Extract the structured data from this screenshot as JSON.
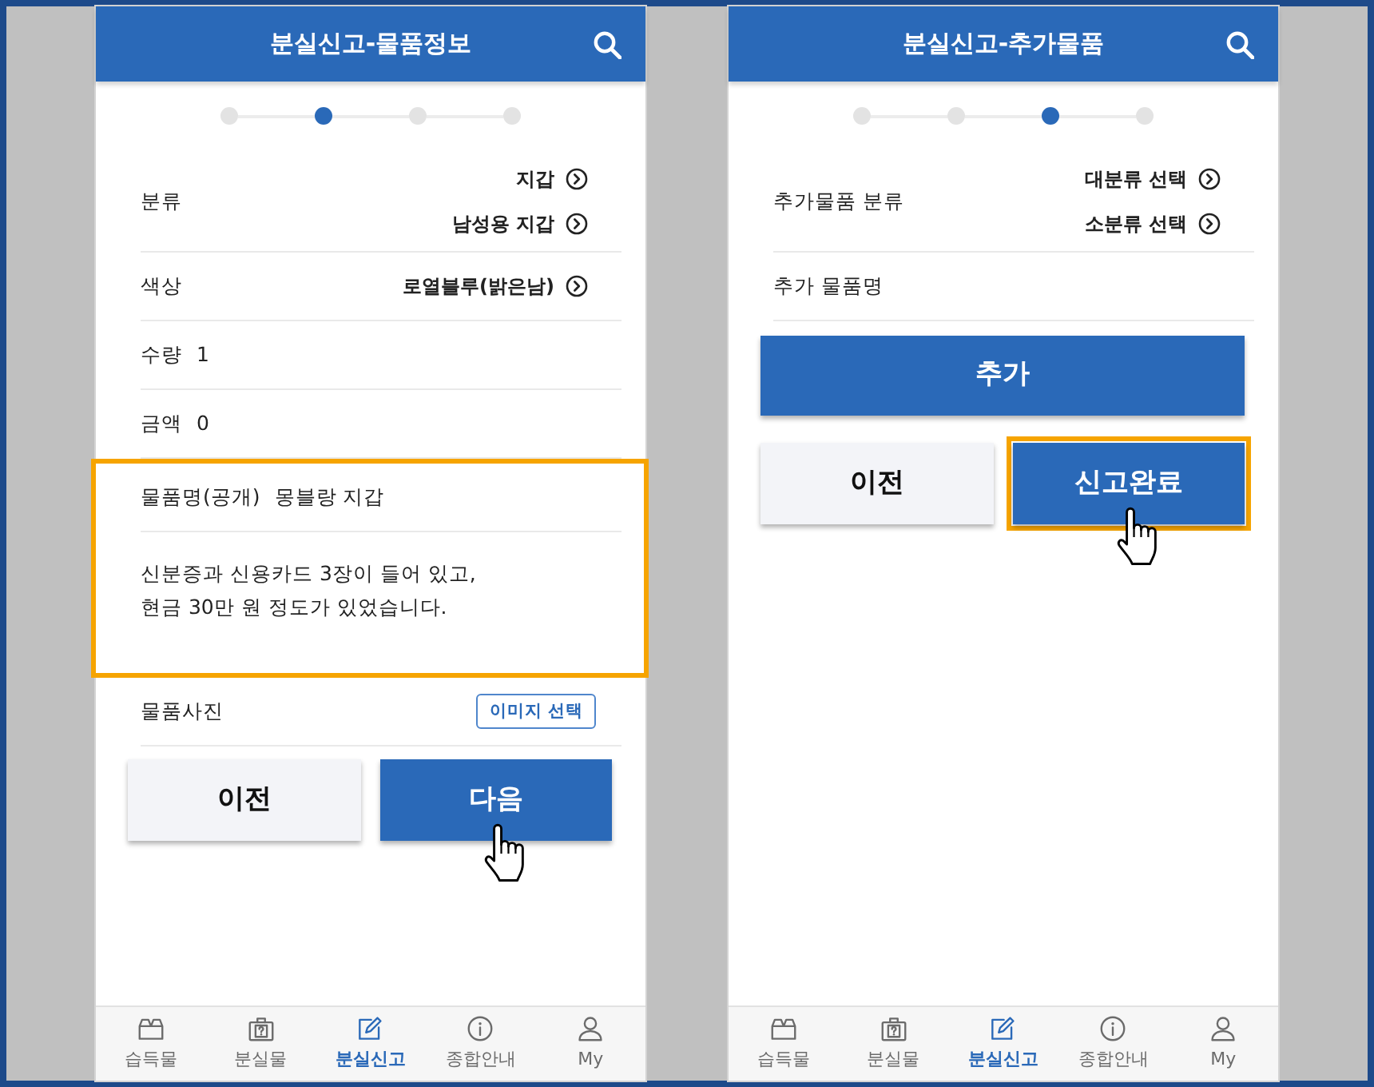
{
  "screens": [
    {
      "title": "분실신고-물품정보",
      "steps": [
        {
          "selected": false
        },
        {
          "selected": true
        },
        {
          "selected": false
        },
        {
          "selected": false
        }
      ],
      "fields": [
        {
          "kind": "select",
          "label": "분류",
          "options": [
            "지갑",
            "남성용 지갑"
          ]
        },
        {
          "kind": "select",
          "label": "색상",
          "options": [
            "로열블루(밝은남)"
          ]
        },
        {
          "kind": "value",
          "label": "수량",
          "value": "1"
        },
        {
          "kind": "value",
          "label": "금액",
          "value": "0"
        },
        {
          "kind": "group",
          "highlighted": true,
          "fields": [
            {
              "kind": "value",
              "label": "물품명(공개)",
              "value": "몽블랑 지갑"
            },
            {
              "kind": "note",
              "text": "신분증과 신용카드 3장이 들어 있고,\n현금 30만 원 정도가 있었습니다."
            }
          ]
        },
        {
          "kind": "upload",
          "label": "물품사진",
          "button": "이미지 선택"
        }
      ],
      "buttons": [
        {
          "kind": "secondary",
          "label": "이전",
          "highlighted": false,
          "pointer": false
        },
        {
          "kind": "primary",
          "label": "다음",
          "highlighted": false,
          "pointer": true
        }
      ],
      "nav": [
        {
          "label": "습득물",
          "selected": false
        },
        {
          "label": "분실물",
          "selected": false
        },
        {
          "label": "분실신고",
          "selected": true
        },
        {
          "label": "종합안내",
          "selected": false
        },
        {
          "label": "My",
          "selected": false
        }
      ]
    },
    {
      "title": "분실신고-추가물품",
      "steps": [
        {
          "selected": false
        },
        {
          "selected": false
        },
        {
          "selected": true
        },
        {
          "selected": false
        }
      ],
      "fields": [
        {
          "kind": "select",
          "label": "추가물품 분류",
          "options": [
            "대분류 선택",
            "소분류 선택"
          ]
        },
        {
          "kind": "label",
          "label": "추가 물품명"
        }
      ],
      "add_button": {
        "label": "추가"
      },
      "buttons": [
        {
          "kind": "secondary",
          "label": "이전",
          "highlighted": false,
          "pointer": false
        },
        {
          "kind": "primary",
          "label": "신고완료",
          "highlighted": true,
          "pointer": true
        }
      ],
      "nav": [
        {
          "label": "습득물",
          "selected": false
        },
        {
          "label": "분실물",
          "selected": false
        },
        {
          "label": "분실신고",
          "selected": true
        },
        {
          "label": "종합안내",
          "selected": false
        },
        {
          "label": "My",
          "selected": false
        }
      ]
    }
  ]
}
